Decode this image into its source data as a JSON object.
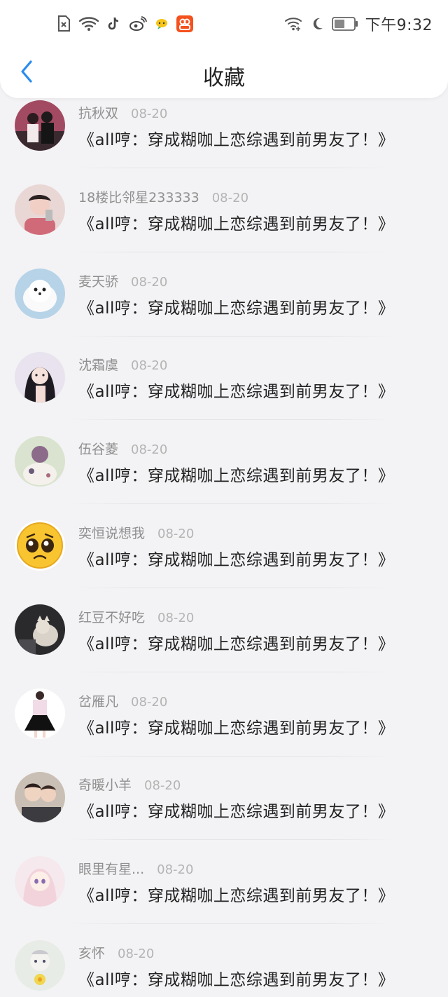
{
  "status_bar": {
    "left_icons": [
      "sim-none-icon",
      "wifi-icon",
      "tiktok-icon",
      "weibo-icon",
      "chat-bubble-icon",
      "app-badge-icon"
    ],
    "right_icons": [
      "wifi-plus-icon",
      "moon-icon",
      "battery-icon"
    ],
    "time": "下午9:32"
  },
  "header": {
    "back_icon": "chevron-left-icon",
    "title": "收藏"
  },
  "colors": {
    "accent": "#2a8cf0",
    "background": "#f3f3f5",
    "name_text": "#8f8f8f",
    "date_text": "#b4b4b4"
  },
  "items": [
    {
      "name": "抗秋双",
      "date": "08-20",
      "content": "《all哼：穿成糊咖上恋综遇到前男友了！》",
      "avatar": "couple-photo-avatar"
    },
    {
      "name": "18楼比邻星233333",
      "date": "08-20",
      "content": "《all哼：穿成糊咖上恋综遇到前男友了！》",
      "avatar": "selfie-photo-avatar"
    },
    {
      "name": "麦天骄",
      "date": "08-20",
      "content": "《all哼：穿成糊咖上恋综遇到前男友了！》",
      "avatar": "white-dog-avatar"
    },
    {
      "name": "沈霜虞",
      "date": "08-20",
      "content": "《all哼：穿成糊咖上恋综遇到前男友了！》",
      "avatar": "anime-girl-avatar"
    },
    {
      "name": "伍谷菱",
      "date": "08-20",
      "content": "《all哼：穿成糊咖上恋综遇到前男友了！》",
      "avatar": "illustration-avatar"
    },
    {
      "name": "奕恒说想我",
      "date": "08-20",
      "content": "《all哼：穿成糊咖上恋综遇到前男友了！》",
      "avatar": "pleading-emoji-avatar"
    },
    {
      "name": "红豆不好吃",
      "date": "08-20",
      "content": "《all哼：穿成糊咖上恋综遇到前男友了！》",
      "avatar": "cat-photo-avatar"
    },
    {
      "name": "岔雁凡",
      "date": "08-20",
      "content": "《all哼：穿成糊咖上恋综遇到前男友了！》",
      "avatar": "skirt-girl-avatar"
    },
    {
      "name": "奇暖小羊",
      "date": "08-20",
      "content": "《all哼：穿成糊咖上恋综遇到前男友了！》",
      "avatar": "boys-photo-avatar"
    },
    {
      "name": "眼里有星...",
      "date": "08-20",
      "content": "《all哼：穿成糊咖上恋综遇到前男友了！》",
      "avatar": "anime-pink-avatar"
    },
    {
      "name": "亥怀",
      "date": "08-20",
      "content": "《all哼：穿成糊咖上恋综遇到前男友了！》",
      "avatar": "flower-avatar"
    }
  ]
}
